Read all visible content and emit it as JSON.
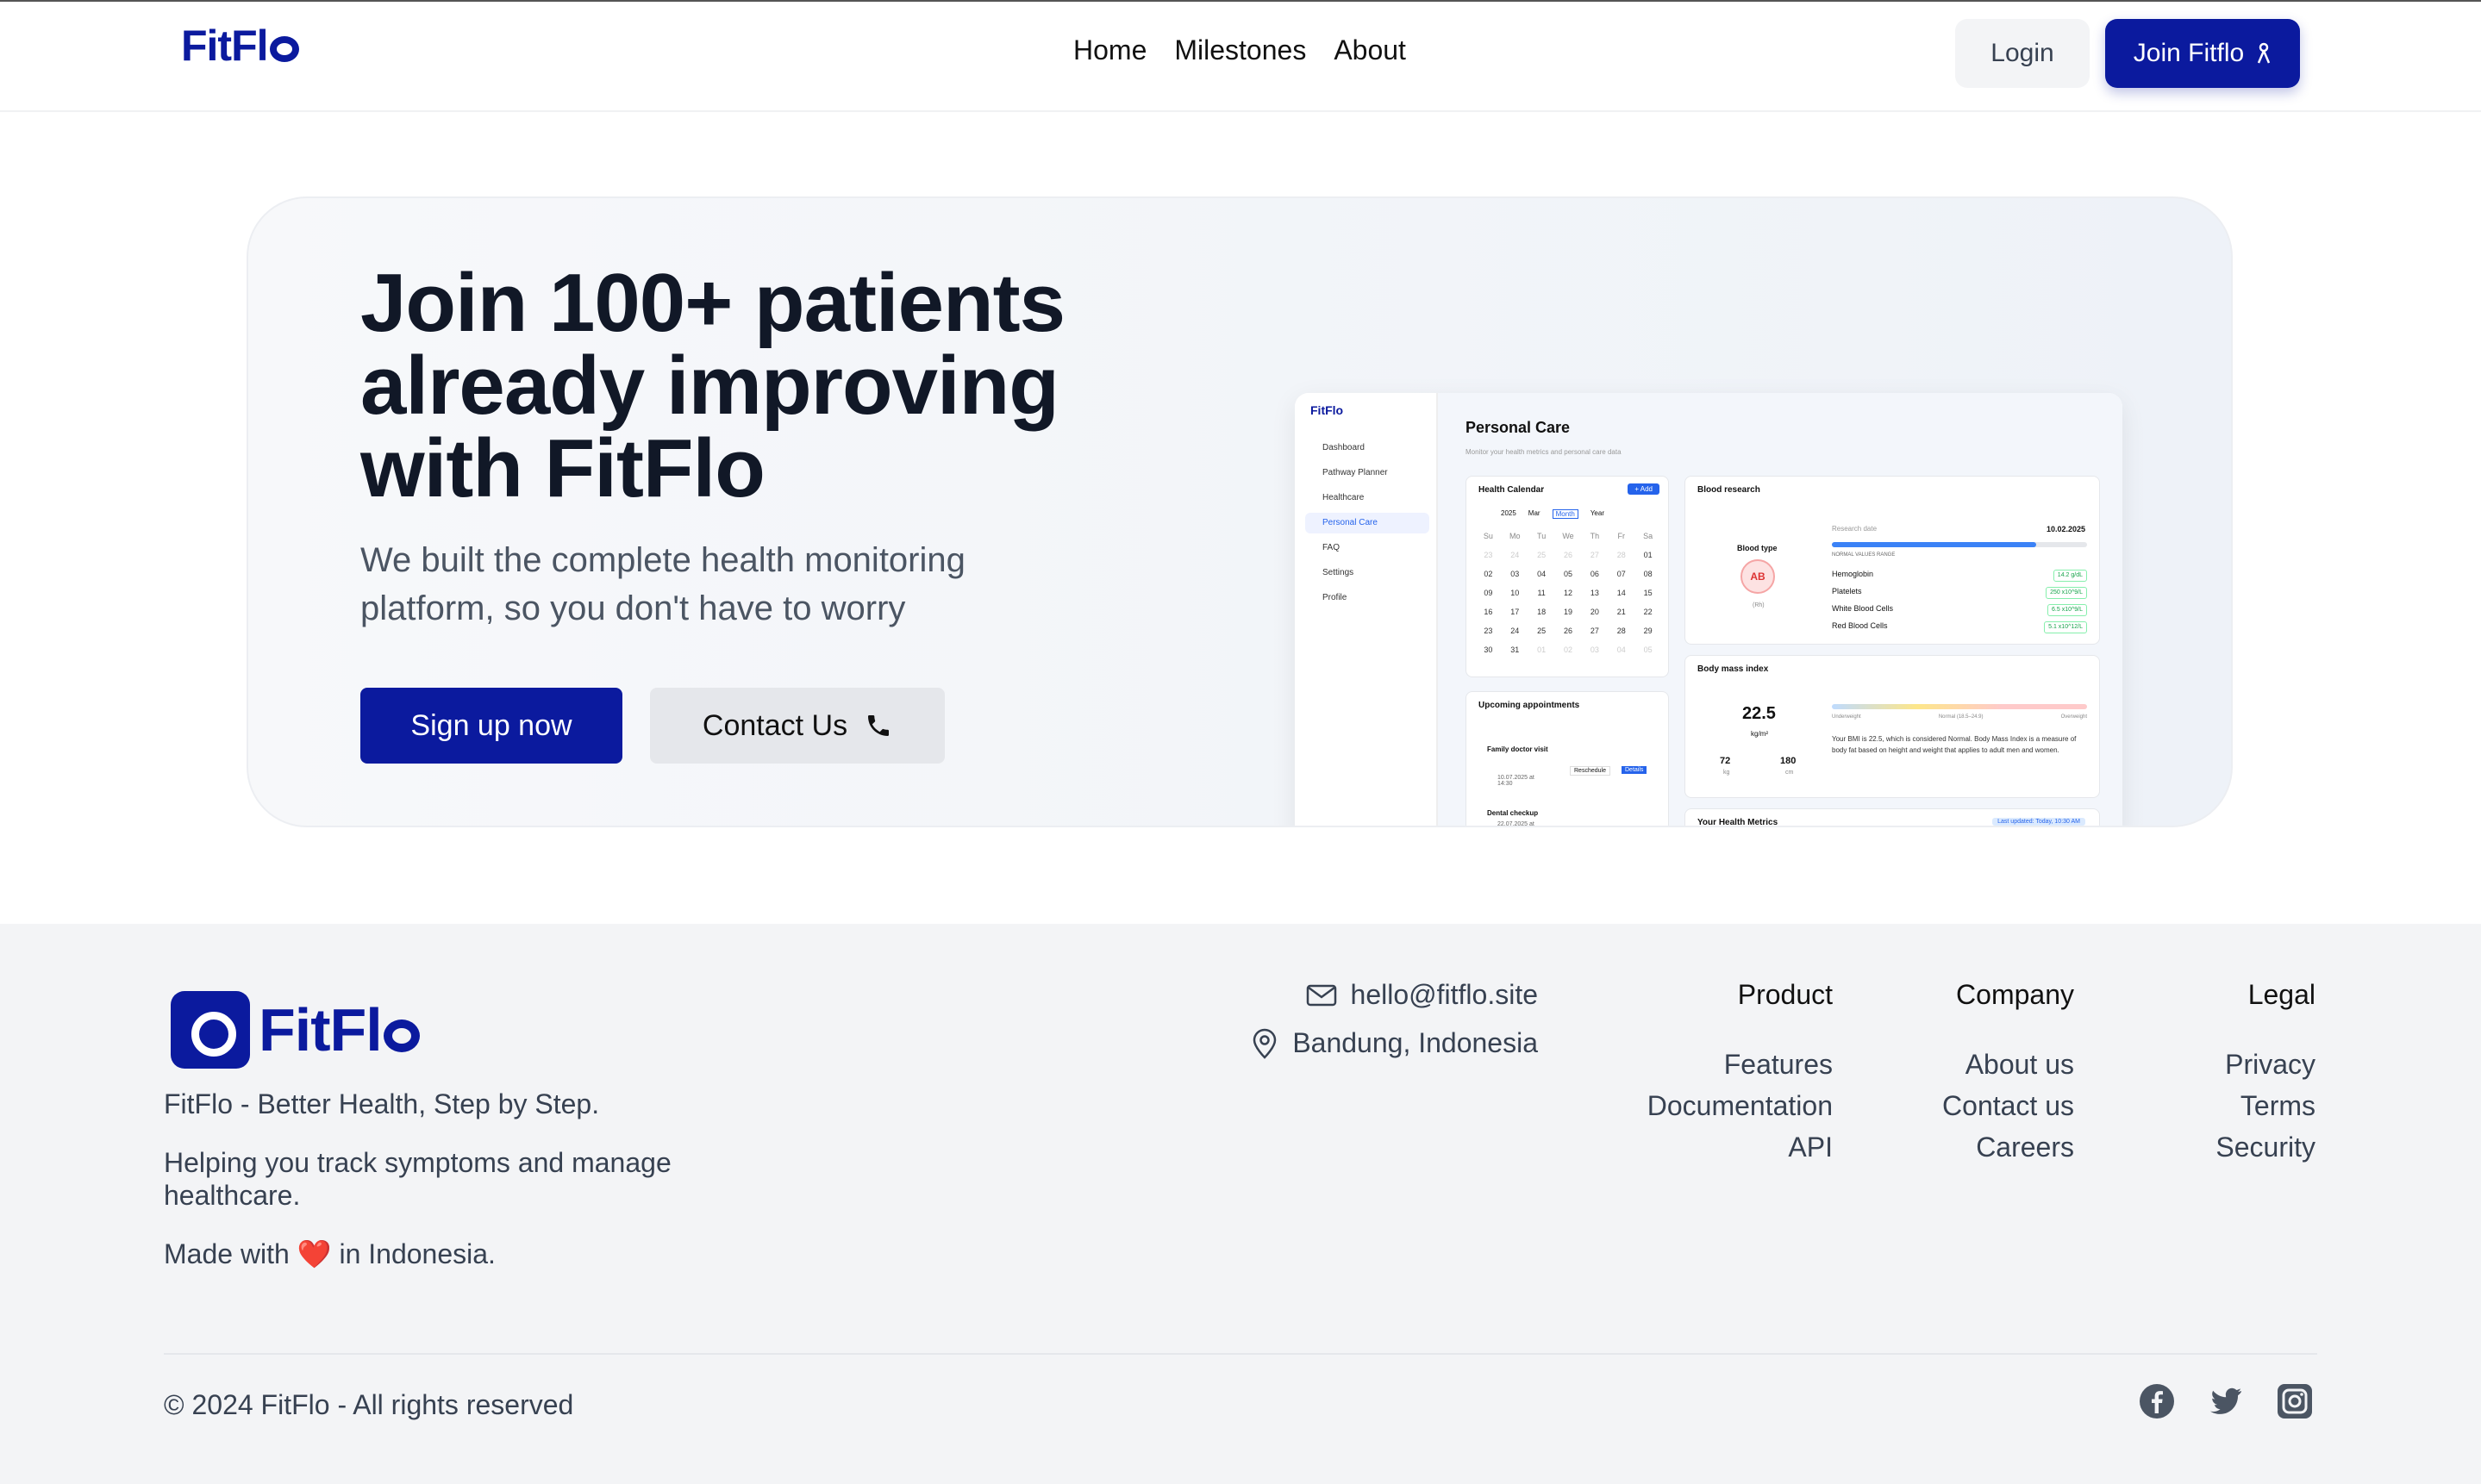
{
  "header": {
    "logo": "FitFl",
    "nav": [
      "Home",
      "Milestones",
      "About"
    ],
    "login_label": "Login",
    "join_label": "Join Fitflo"
  },
  "hero": {
    "title": "Join 100+ patients already improving with FitFlo",
    "subtitle": "We built the complete health monitoring platform, so you don't have to worry",
    "signup_label": "Sign up now",
    "contact_label": "Contact Us"
  },
  "mockup": {
    "logo": "FitFlo",
    "sidebar": [
      "Dashboard",
      "Pathway Planner",
      "Healthcare",
      "Personal Care",
      "FAQ",
      "Settings",
      "Profile"
    ],
    "page_title": "Personal Care",
    "page_sub": "Monitor your health metrics and personal care data",
    "calendar_title": "Health Calendar",
    "calendar_add": "+ Add",
    "calendar_year": "2025",
    "calendar_month": "Mar",
    "calendar_view_month": "Month",
    "calendar_view_year": "Year",
    "weekdays": [
      "Su",
      "Mo",
      "Tu",
      "We",
      "Th",
      "Fr",
      "Sa"
    ],
    "days": [
      "23",
      "24",
      "25",
      "26",
      "27",
      "28",
      "01",
      "02",
      "03",
      "04",
      "05",
      "06",
      "07",
      "08",
      "09",
      "10",
      "11",
      "12",
      "13",
      "14",
      "15",
      "16",
      "17",
      "18",
      "19",
      "20",
      "21",
      "22",
      "23",
      "24",
      "25",
      "26",
      "27",
      "28",
      "29",
      "30",
      "31",
      "01",
      "02",
      "03",
      "04",
      "05"
    ],
    "selected_day": "15",
    "appointments_title": "Upcoming appointments",
    "appt1": "Family doctor visit",
    "appt1_date": "10.07.2025 at 14:30",
    "appt2": "Dental checkup",
    "appt2_date": "22.07.2025 at",
    "reschedule": "Reschedule",
    "details": "Details",
    "blood_title": "Blood research",
    "blood_type_label": "Blood type",
    "blood_type": "AB",
    "blood_rh": "(Rh)",
    "research_date_label": "Research date",
    "research_date": "10.02.2025",
    "normal_range": "NORMAL VALUES RANGE",
    "blood_rows": [
      {
        "name": "Hemoglobin",
        "value": "14.2 g/dL"
      },
      {
        "name": "Platelets",
        "value": "250 x10^9/L"
      },
      {
        "name": "White Blood Cells",
        "value": "6.5 x10^9/L"
      },
      {
        "name": "Red Blood Cells",
        "value": "5.1 x10^12/L"
      }
    ],
    "bmi_title": "Body mass index",
    "bmi_value": "22.5",
    "bmi_unit": "kg/m²",
    "weight": "72",
    "weight_unit": "kg",
    "height": "180",
    "height_unit": "cm",
    "bmi_scale": [
      "Underweight",
      "Normal (18.5–24.9)",
      "Overweight"
    ],
    "bmi_text": "Your BMI is 22.5, which is considered Normal. Body Mass Index is a measure of body fat based on height and weight that applies to adult men and women.",
    "metrics_title": "Your Health Metrics",
    "metrics_updated": "Last updated: Today, 10:30 AM"
  },
  "footer": {
    "logo": "FitFl",
    "tagline": "FitFlo - Better Health, Step by Step.",
    "desc": "Helping you track symptoms and manage healthcare.",
    "made_prefix": "Made with",
    "made_suffix": "in Indonesia.",
    "email": "hello@fitflo.site",
    "location": "Bandung, Indonesia",
    "product": {
      "title": "Product",
      "links": [
        "Features",
        "Documentation",
        "API"
      ]
    },
    "company": {
      "title": "Company",
      "links": [
        "About us",
        "Contact us",
        "Careers"
      ]
    },
    "legal": {
      "title": "Legal",
      "links": [
        "Privacy",
        "Terms",
        "Security"
      ]
    },
    "copyright": "© 2024 FitFlo - All rights reserved",
    "social": [
      "facebook-icon",
      "twitter-icon",
      "instagram-icon"
    ]
  },
  "colors": {
    "brand": "#0b1a9e",
    "accent": "#2563eb"
  }
}
